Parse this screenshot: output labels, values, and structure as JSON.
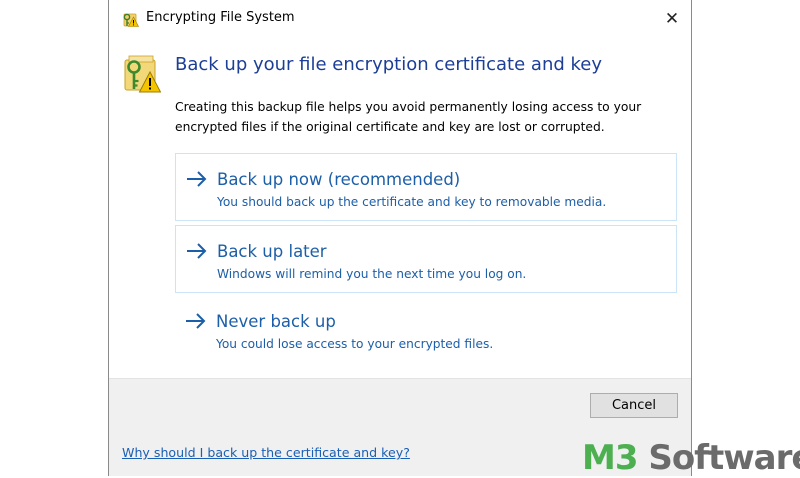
{
  "window": {
    "title": "Encrypting File System",
    "close_symbol": "✕"
  },
  "header": {
    "heading": "Back up your file encryption certificate and key",
    "description": "Creating this backup file helps you avoid permanently losing access to your encrypted files if the original certificate and key are lost or corrupted."
  },
  "options": [
    {
      "title": "Back up now (recommended)",
      "subtitle": "You should back up the certificate and key to removable media."
    },
    {
      "title": "Back up later",
      "subtitle": "Windows will remind you the next time you log on."
    },
    {
      "title": "Never back up",
      "subtitle": "You could lose access to your encrypted files."
    }
  ],
  "footer": {
    "cancel_label": "Cancel",
    "help_link": "Why should I back up the certificate and key?"
  },
  "watermark": {
    "prefix": "M3",
    "suffix": " Software"
  },
  "icons": {
    "title": "key-warning-icon",
    "header": "key-warning-icon",
    "option_arrow": "arrow-right-icon"
  },
  "colors": {
    "heading": "#1c3e96",
    "option_text": "#1c5fa8",
    "link": "#1a5fb4",
    "option_border": "#cce4f7",
    "footer_bg": "#f0f0f0",
    "brand_green": "#4caf50",
    "brand_gray": "#6b6b6b"
  }
}
